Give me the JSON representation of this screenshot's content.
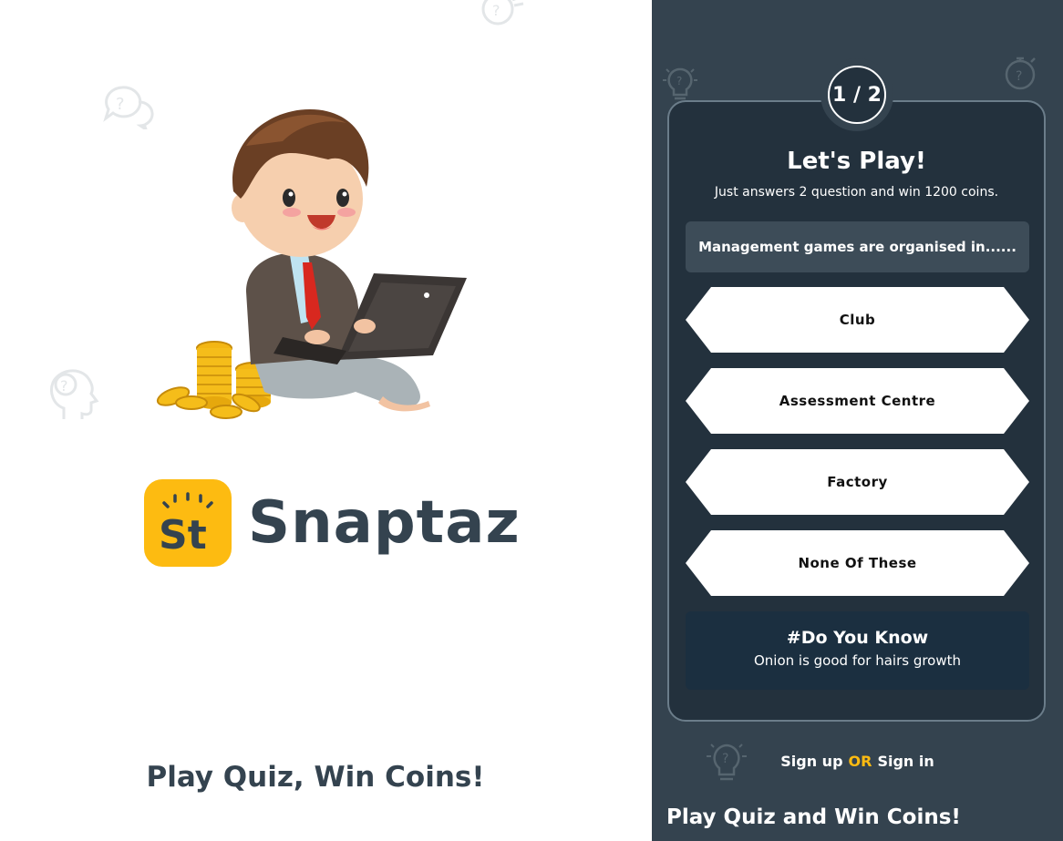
{
  "brand": {
    "name": "Snaptaz",
    "logo_letters": "St"
  },
  "left": {
    "tagline": "Play Quiz, Win Coins!"
  },
  "quiz": {
    "step": "1 / 2",
    "title": "Let's Play!",
    "subtitle": "Just answers 2 question and win 1200 coins.",
    "question": "Management games are organised in......",
    "options": [
      "Club",
      "Assessment Centre",
      "Factory",
      "None Of These"
    ]
  },
  "did_you_know": {
    "title": "#Do You Know",
    "text": "Onion is good for hairs growth"
  },
  "auth": {
    "signup": "Sign up",
    "or": "OR",
    "signin": "Sign in"
  },
  "right": {
    "tagline": "Play Quiz and Win Coins!"
  },
  "colors": {
    "accent": "#fdbb11",
    "panel": "#34434f",
    "card": "#23313d",
    "brand_text": "#34434f"
  },
  "icons": [
    "question-bubble-icon",
    "head-question-icon",
    "lightbulb-question-icon",
    "stopwatch-question-icon"
  ]
}
